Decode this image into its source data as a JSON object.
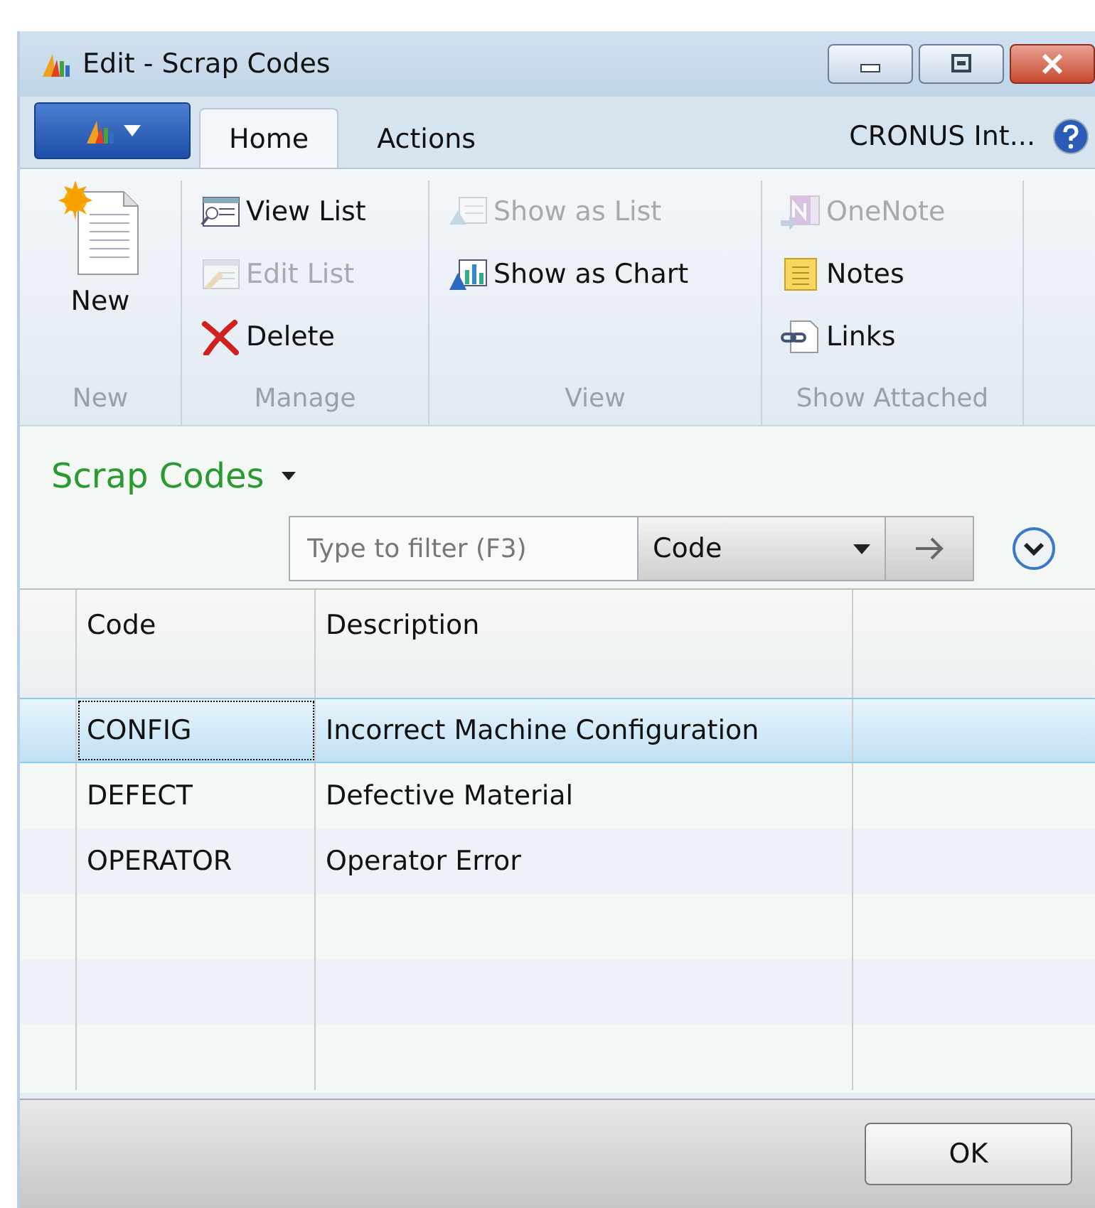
{
  "window": {
    "title": "Edit - Scrap Codes"
  },
  "tabs": [
    {
      "label": "Home",
      "selected": true
    },
    {
      "label": "Actions",
      "selected": false
    }
  ],
  "company": "CRONUS Int...",
  "ribbon": {
    "groups": [
      {
        "label": "New",
        "items": [
          {
            "label": "New",
            "kind": "large",
            "disabled": false
          }
        ]
      },
      {
        "label": "Manage",
        "items": [
          {
            "label": "View List",
            "kind": "small",
            "disabled": false
          },
          {
            "label": "Edit List",
            "kind": "small",
            "disabled": true
          },
          {
            "label": "Delete",
            "kind": "small",
            "disabled": false
          }
        ]
      },
      {
        "label": "View",
        "items": [
          {
            "label": "Show as List",
            "kind": "small",
            "disabled": true
          },
          {
            "label": "Show as Chart",
            "kind": "small",
            "disabled": false
          }
        ]
      },
      {
        "label": "Show Attached",
        "items": [
          {
            "label": "OneNote",
            "kind": "small",
            "disabled": true
          },
          {
            "label": "Notes",
            "kind": "small",
            "disabled": false
          },
          {
            "label": "Links",
            "kind": "small",
            "disabled": false
          }
        ]
      }
    ]
  },
  "page_title": "Scrap Codes",
  "filter": {
    "placeholder": "Type to filter (F3)",
    "field": "Code"
  },
  "table": {
    "columns": [
      "Code",
      "Description"
    ],
    "rows": [
      {
        "cells": [
          "CONFIG",
          "Incorrect Machine Configuration"
        ],
        "selected": true
      },
      {
        "cells": [
          "DEFECT",
          "Defective Material"
        ],
        "selected": false
      },
      {
        "cells": [
          "OPERATOR",
          "Operator Error"
        ],
        "selected": false
      }
    ]
  },
  "buttons": [
    "OK"
  ]
}
